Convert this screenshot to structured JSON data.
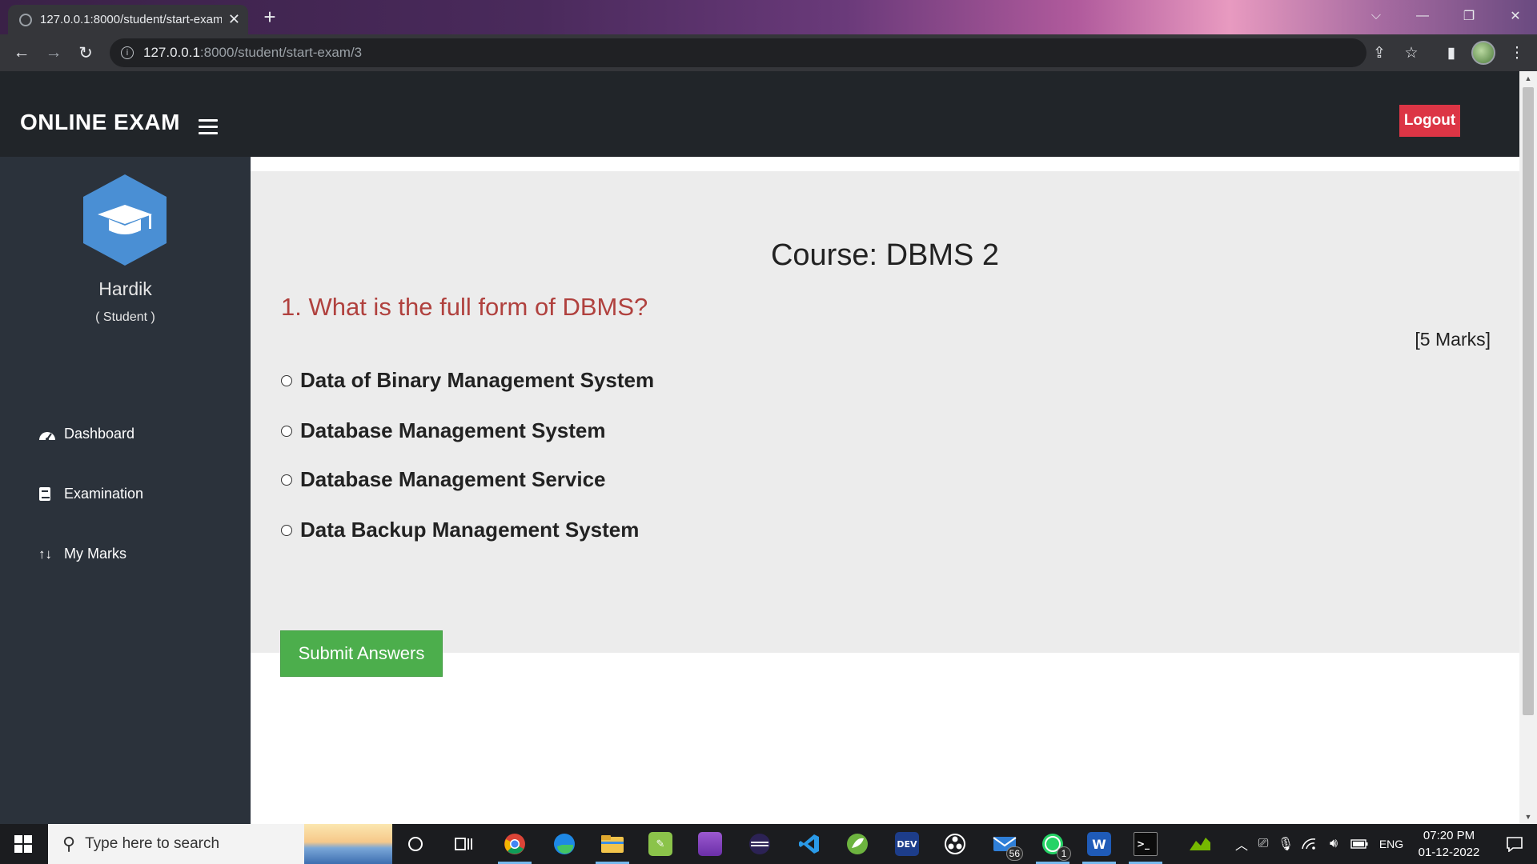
{
  "browser": {
    "tab_title": "127.0.0.1:8000/student/start-exam/3",
    "tab_close": "✕",
    "new_tab": "+",
    "url_host": "127.0.0.1",
    "url_path": ":8000/student/start-exam/3"
  },
  "header": {
    "brand": "ONLINE EXAM",
    "logout_label": "Logout"
  },
  "sidebar": {
    "user_name": "Hardik",
    "user_role": "( Student )",
    "items": [
      {
        "label": "Dashboard",
        "icon": "tachometer-icon"
      },
      {
        "label": "Examination",
        "icon": "book-icon"
      },
      {
        "label": "My Marks",
        "icon": "sort-arrows-icon"
      }
    ]
  },
  "exam": {
    "course": "Course: DBMS 2",
    "question": "1. What is the full form of DBMS?",
    "marks": "[5 Marks]",
    "options": [
      "Data of Binary Management System",
      "Database Management System",
      "Database Management Service",
      "Data Backup Management System"
    ],
    "submit_label": "Submit Answers"
  },
  "taskbar": {
    "search_placeholder": "Type here to search",
    "mail_badge": "56",
    "whatsapp_badge": "1",
    "language": "ENG",
    "time": "07:20 PM",
    "date": "01-12-2022"
  },
  "colors": {
    "header_bg": "#212529",
    "sidebar_bg": "#2b323b",
    "logout_bg": "#dc3545",
    "question_color": "#b0413e",
    "submit_bg": "#4cae4c",
    "avatar_bg": "#4a8fd4"
  }
}
